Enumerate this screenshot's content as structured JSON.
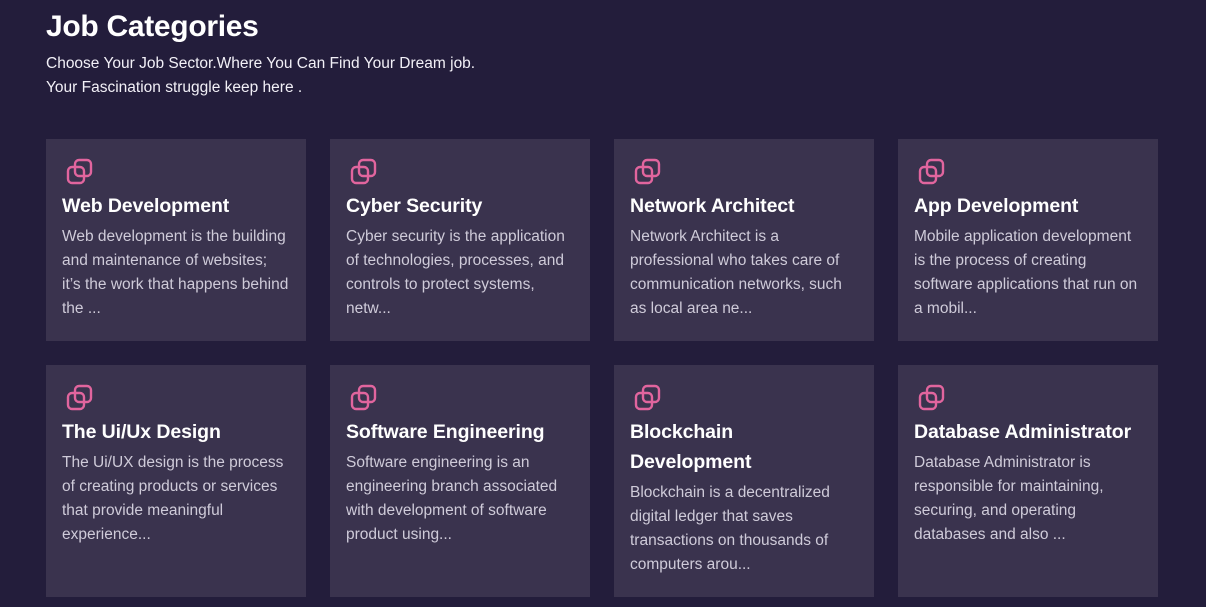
{
  "header": {
    "title": "Job Categories",
    "subtitle_line1": "Choose Your Job Sector.Where You Can Find Your Dream job.",
    "subtitle_line2": "Your Fascination struggle keep here ."
  },
  "colors": {
    "background": "#231d3b",
    "card": "#3a334e",
    "icon_accent": "#e1659e"
  },
  "categories": [
    {
      "icon": "copy-icon",
      "title": "Web Development",
      "description": "Web development is the building and maintenance of websites; it’s the work that happens behind the ..."
    },
    {
      "icon": "copy-icon",
      "title": "Cyber Security",
      "description": "Cyber security is the application of technologies, processes, and controls to protect systems, netw..."
    },
    {
      "icon": "copy-icon",
      "title": "Network Architect",
      "description": "Network Architect is a professional who takes care of communication networks, such as local area ne..."
    },
    {
      "icon": "copy-icon",
      "title": "App Development",
      "description": "Mobile application development is the process of creating software applications that run on a mobil..."
    },
    {
      "icon": "copy-icon",
      "title": "The Ui/Ux Design",
      "description": "The Ui/UX design is the process of creating products or services that provide meaningful experience..."
    },
    {
      "icon": "copy-icon",
      "title": "Software Engineering",
      "description": "Software engineering is an engineering branch associated with development of software product using..."
    },
    {
      "icon": "copy-icon",
      "title": "Blockchain Development",
      "description": "Blockchain is a decentralized digital ledger that saves transactions on thousands of computers arou..."
    },
    {
      "icon": "copy-icon",
      "title": "Database Administrator",
      "description": "Database Administrator is responsible for maintaining, securing, and operating databases and also ..."
    }
  ]
}
